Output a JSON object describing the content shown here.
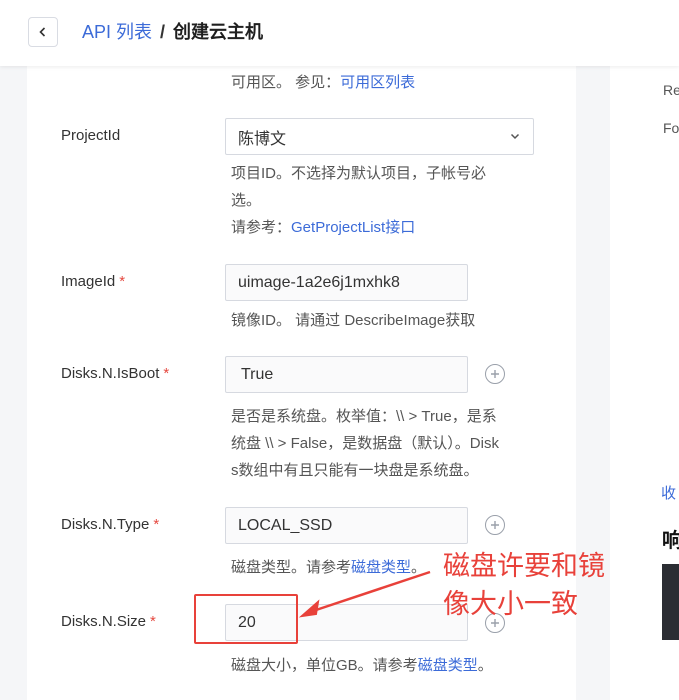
{
  "header": {
    "breadcrumb_link": "API 列表",
    "separator": "/",
    "current_page": "创建云主机"
  },
  "form": {
    "zone_help": {
      "prefix": "可用区。 参见：",
      "link": "可用区列表"
    },
    "project_id": {
      "label": "ProjectId",
      "value": "陈博文",
      "help_line1": "项目ID。不选择为默认项目，子帐号必",
      "help_line2": "选。",
      "help_ref_prefix": "请参考：",
      "help_ref_link": "GetProjectList接口"
    },
    "image_id": {
      "label": "ImageId",
      "required_mark": "*",
      "value": "uimage-1a2e6j1mxhk8",
      "help": "镜像ID。 请通过 DescribeImage获取"
    },
    "disks_is_boot": {
      "label": "Disks.N.IsBoot",
      "required_mark": "*",
      "value": "True",
      "help_line1": "是否是系统盘。枚举值：\\\\ > True，是系",
      "help_line2": "统盘 \\\\ > False，是数据盘（默认）。Disk",
      "help_line3": "s数组中有且只能有一块盘是系统盘。"
    },
    "disks_type": {
      "label": "Disks.N.Type",
      "required_mark": "*",
      "value": "LOCAL_SSD",
      "help_prefix": "磁盘类型。请参考",
      "help_link": "磁盘类型",
      "help_suffix": "。"
    },
    "disks_size": {
      "label": "Disks.N.Size",
      "required_mark": "*",
      "value": "20",
      "help_prefix": "磁盘大小，单位GB。请参考",
      "help_link": "磁盘类型",
      "help_suffix": "。"
    }
  },
  "right_panel": {
    "text1": "Re",
    "text2": "Fo",
    "link": "收",
    "bold": "响"
  },
  "annotation": {
    "line1": "磁盘许要和镜",
    "line2": "像大小一致",
    "color": "#e8413a"
  },
  "colors": {
    "link": "#3c6bd8",
    "required": "#e5483f"
  }
}
